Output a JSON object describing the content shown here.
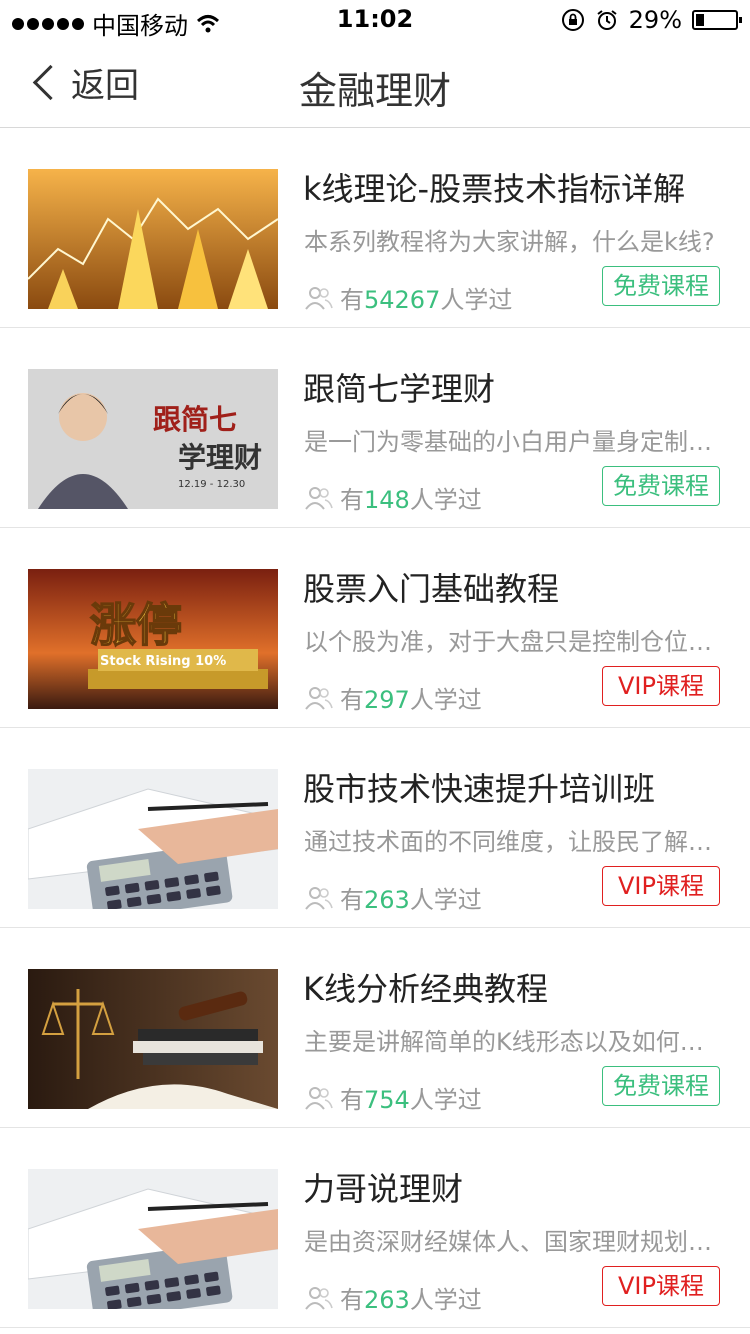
{
  "status": {
    "carrier": "中国移动",
    "time": "11:02",
    "battery": "29%"
  },
  "nav": {
    "back_label": "返回",
    "title": "金融理财"
  },
  "courses": [
    {
      "title": "k线理论-股票技术指标详解",
      "desc": "本系列教程将为大家讲解，什么是k线?",
      "prefix": "有",
      "count": "54267",
      "suffix": "人学过",
      "tag": "免费课程",
      "tag_type": "free",
      "thumb": "stock-chart-image"
    },
    {
      "title": "跟简七学理财",
      "desc": "是一门为零基础的小白用户量身定制…",
      "prefix": "有",
      "count": "148",
      "suffix": "人学过",
      "tag": "免费课程",
      "tag_type": "free",
      "thumb": "instructor-banner-image",
      "thumb_text": [
        "跟简七",
        "学理财",
        "12.19 - 12.30"
      ]
    },
    {
      "title": "股票入门基础教程",
      "desc": "以个股为准，对于大盘只是控制仓位…",
      "prefix": "有",
      "count": "297",
      "suffix": "人学过",
      "tag": "VIP课程",
      "tag_type": "vip",
      "thumb": "zhangting-banner-image",
      "thumb_text": [
        "涨停",
        "Stock Rising 10%"
      ]
    },
    {
      "title": "股市技术快速提升培训班",
      "desc": "通过技术面的不同维度，让股民了解…",
      "prefix": "有",
      "count": "263",
      "suffix": "人学过",
      "tag": "VIP课程",
      "tag_type": "vip",
      "thumb": "calculator-image"
    },
    {
      "title": "K线分析经典教程",
      "desc": "主要是讲解简单的K线形态以及如何…",
      "prefix": "有",
      "count": "754",
      "suffix": "人学过",
      "tag": "免费课程",
      "tag_type": "free",
      "thumb": "law-books-image"
    },
    {
      "title": "力哥说理财",
      "desc": "是由资深财经媒体人、国家理财规划…",
      "prefix": "有",
      "count": "263",
      "suffix": "人学过",
      "tag": "VIP课程",
      "tag_type": "vip",
      "thumb": "calculator-image"
    }
  ]
}
